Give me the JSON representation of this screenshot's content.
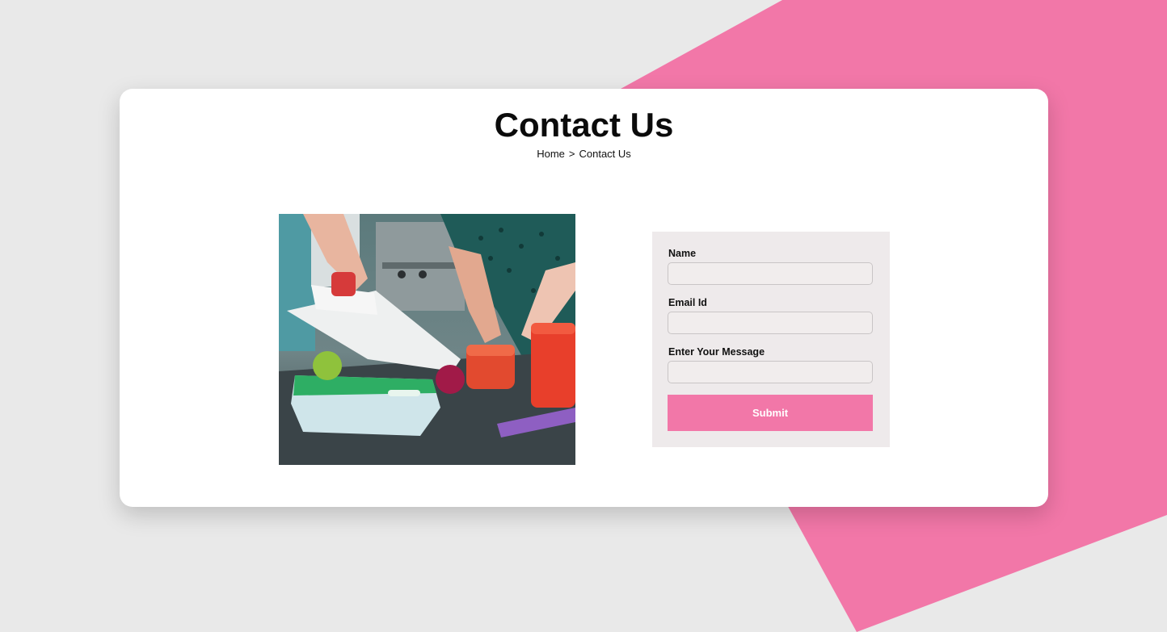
{
  "header": {
    "title": "Contact Us",
    "breadcrumb": {
      "home": "Home",
      "separator": ">",
      "current": "Contact Us"
    }
  },
  "image": {
    "subject": "kitchen-prep-photo"
  },
  "form": {
    "name_label": "Name",
    "name_value": "",
    "name_placeholder": "",
    "email_label": "Email Id",
    "email_value": "",
    "email_placeholder": "",
    "message_label": "Enter Your Message",
    "message_value": "",
    "message_placeholder": "",
    "submit_label": "Submit"
  },
  "colors": {
    "background": "#e9e9e9",
    "accent": "#f277a8",
    "card": "#ffffff",
    "form_panel": "#eeeaeb"
  }
}
